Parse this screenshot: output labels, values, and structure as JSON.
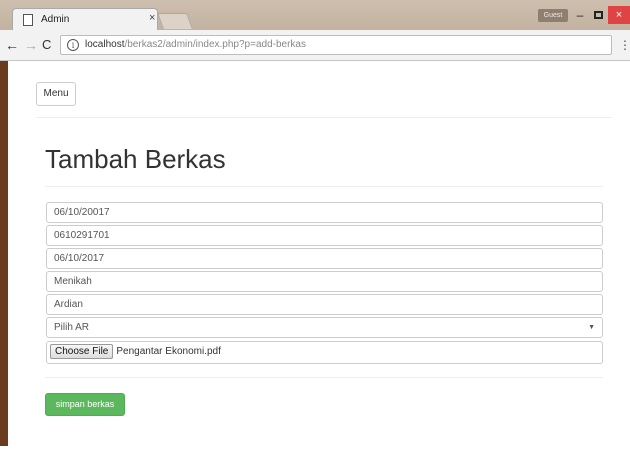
{
  "browser": {
    "tab_title": "Admin",
    "tab_close": "×",
    "guest_label": "Guest",
    "minimize": "–",
    "close": "×",
    "url_host": "localhost",
    "url_path": "/berkas2/admin/index.php?p=add-berkas",
    "back": "←",
    "forward": "→",
    "reload": "C",
    "info": "i",
    "menu_dots": "⋮"
  },
  "page": {
    "menu_label": "Menu",
    "title": "Tambah Berkas",
    "fields": [
      "06/10/20017",
      "0610291701",
      "06/10/2017",
      "Menikah",
      "Ardian"
    ],
    "select": {
      "value": "Pilih AR",
      "arrow": "▼"
    },
    "file": {
      "button_label": "Choose File",
      "file_name": "Pengantar Ekonomi.pdf"
    },
    "submit_label": "simpan berkas"
  },
  "colors": {
    "accent_green": "#5cb85c",
    "close_red": "#e04343"
  }
}
